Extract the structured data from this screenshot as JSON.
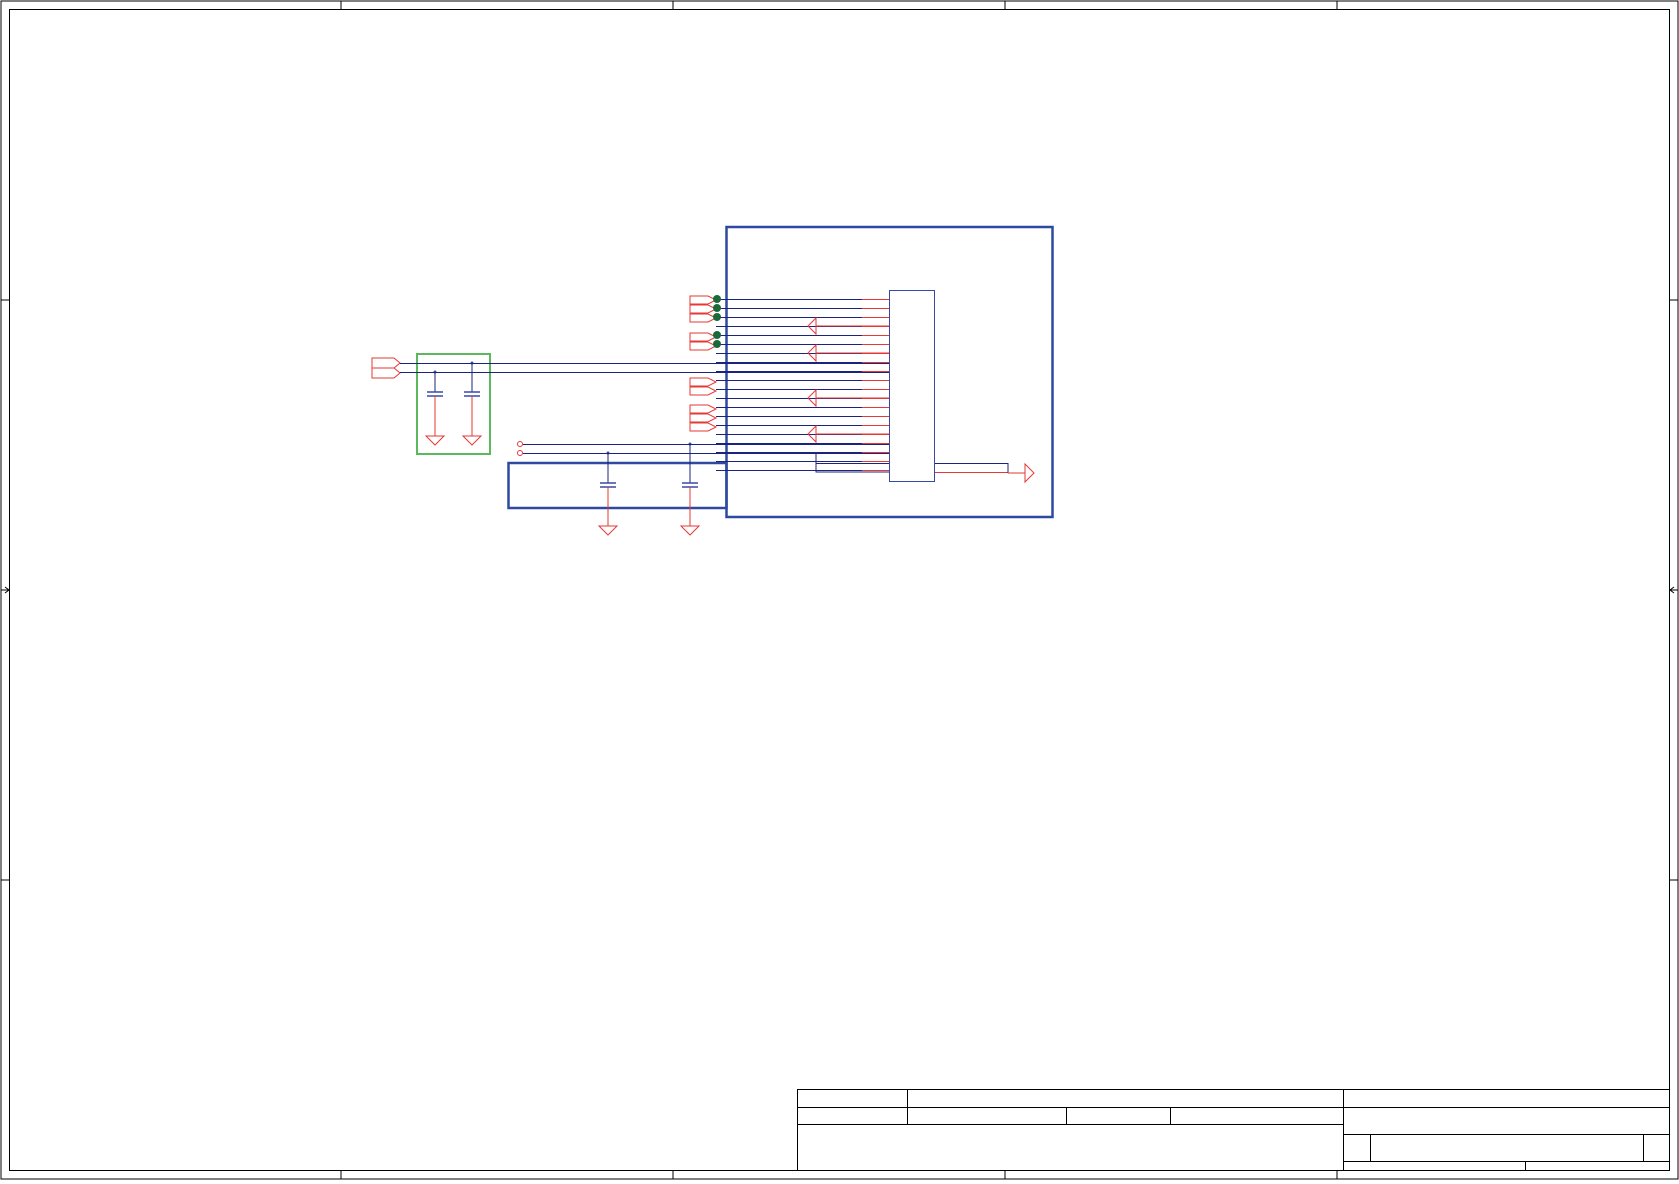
{
  "colors": {
    "border": "#000000",
    "wire": "#1a237e",
    "net": "#e53935",
    "block": "#2e4aa0",
    "filter_box": "#5cb85c",
    "junction": "#1b6b3a",
    "component": "#3949ab"
  },
  "icons": {
    "net_port": "net-port-icon",
    "ground": "ground-icon",
    "capacitor": "capacitor-icon",
    "junction": "junction-dot-icon",
    "test_point": "test-point-icon"
  }
}
